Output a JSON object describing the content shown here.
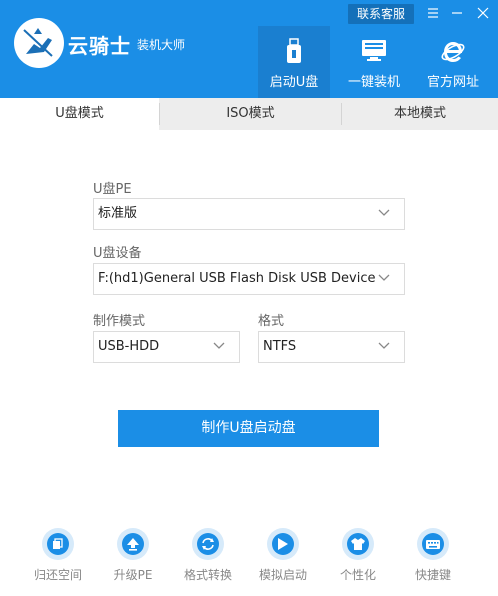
{
  "app": {
    "title": "云骑士",
    "subtitle": "装机大师",
    "contact_label": "联系客服"
  },
  "nav": [
    {
      "label": "启动U盘",
      "icon": "usb-drive-icon",
      "active": true
    },
    {
      "label": "一键装机",
      "icon": "monitor-icon",
      "active": false
    },
    {
      "label": "官方网址",
      "icon": "browser-e-icon",
      "active": false
    }
  ],
  "tabs": [
    {
      "label": "U盘模式",
      "active": true
    },
    {
      "label": "ISO模式",
      "active": false
    },
    {
      "label": "本地模式",
      "active": false
    }
  ],
  "form": {
    "pe_label": "U盘PE",
    "pe_value": "标准版",
    "device_label": "U盘设备",
    "device_value": "F:(hd1)General USB Flash Disk USB Device",
    "mode_label": "制作模式",
    "mode_value": "USB-HDD",
    "format_label": "格式",
    "format_value": "NTFS",
    "submit_label": "制作U盘启动盘"
  },
  "tools": [
    {
      "label": "归还空间",
      "icon": "restore-space-icon"
    },
    {
      "label": "升级PE",
      "icon": "upgrade-icon"
    },
    {
      "label": "格式转换",
      "icon": "convert-icon"
    },
    {
      "label": "模拟启动",
      "icon": "simulate-icon"
    },
    {
      "label": "个性化",
      "icon": "shirt-icon"
    },
    {
      "label": "快捷键",
      "icon": "keyboard-icon"
    }
  ],
  "colors": {
    "accent": "#1b8ee6",
    "header_active": "#1a7fd0",
    "tab_bg": "#ededed"
  }
}
